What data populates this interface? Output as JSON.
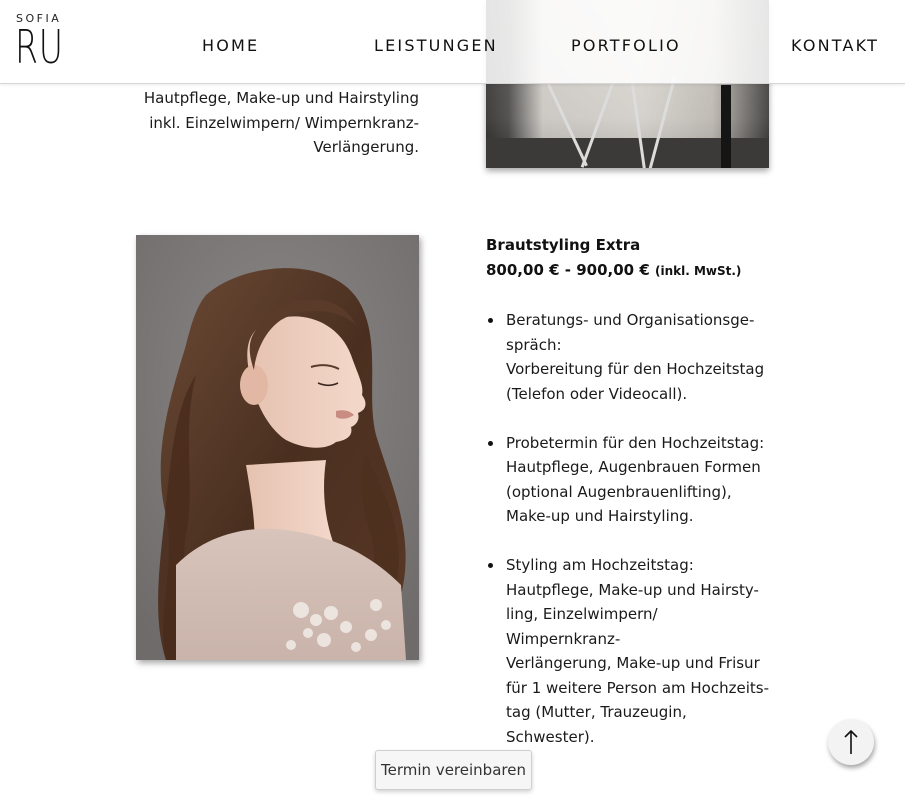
{
  "logo": {
    "small": "SOFIA",
    "big": "RU"
  },
  "nav": [
    {
      "label": "HOME"
    },
    {
      "label": "LEISTUNGEN"
    },
    {
      "label": "PORTFOLIO"
    },
    {
      "label": "KONTAKT"
    }
  ],
  "previous_item": {
    "lines": [
      "Hautpflege, Make-up und Hairstyling",
      "inkl. Einzelwimpern/ Wimpernkranz-",
      "Verlängerung."
    ]
  },
  "product": {
    "title": "Brautstyling Extra",
    "price": "800,00 € - 900,00 €",
    "price_note": "(inkl. MwSt.)",
    "features": [
      {
        "lines": [
          "Beratungs- und Organisationsge-",
          "spräch:",
          "Vorbereitung für den Hochzeitstag",
          "(Telefon oder Videocall)."
        ]
      },
      {
        "lines": [
          "Probetermin für den Hochzeitstag:",
          "Hautpflege, Augenbrauen Formen",
          "(optional Augenbrauenlifting),",
          "Make-up und Hairstyling."
        ]
      },
      {
        "lines": [
          "Styling am Hochzeitstag:",
          "Hautpflege, Make-up und Hairsty-",
          "ling, Einzelwimpern/ Wimpernkranz-",
          "Verlängerung, Make-up und Frisur",
          "für 1 weitere Person am Hochzeits-",
          "tag (Mutter, Trauzeugin, Schwester)."
        ]
      }
    ]
  },
  "cta_label": "Termin vereinbaren",
  "icons": {
    "scroll_top": "arrow-up-icon"
  }
}
